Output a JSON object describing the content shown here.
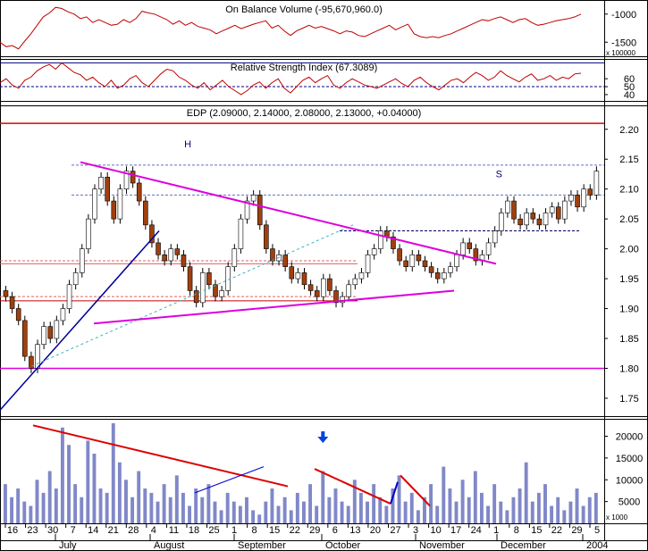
{
  "chart_data": [
    {
      "type": "line",
      "panel": "obv",
      "title": "On Balance Volume (-95,670,960.0)",
      "ylim": [
        -1750,
        -750
      ],
      "yticks": [
        -1500,
        -1000
      ],
      "scale_note": "x 100000",
      "series": [
        {
          "values": [
            -1500,
            -1580,
            -1560,
            -1620,
            -1480,
            -1350,
            -1200,
            -1050,
            -980,
            -880,
            -900,
            -960,
            -1000,
            -1080,
            -1050,
            -1150,
            -1100,
            -1150,
            -1200,
            -1180,
            -1100,
            -1150,
            -1080,
            -950,
            -980,
            -1000,
            -1050,
            -1100,
            -1180,
            -1120,
            -1200,
            -1150,
            -1220,
            -1250,
            -1280,
            -1350,
            -1300,
            -1250,
            -1200,
            -1260,
            -1220,
            -1180,
            -1150,
            -1120,
            -1250,
            -1200,
            -1300,
            -1380,
            -1300,
            -1250,
            -1200,
            -1250,
            -1220,
            -1260,
            -1300,
            -1350,
            -1300,
            -1320,
            -1380,
            -1400,
            -1350,
            -1300,
            -1250,
            -1200,
            -1280,
            -1230,
            -1180,
            -1350,
            -1400,
            -1420,
            -1400,
            -1420,
            -1380,
            -1350,
            -1300,
            -1250,
            -1200,
            -1150,
            -1100,
            -1120,
            -1080,
            -1050,
            -1100,
            -1150,
            -1100,
            -1080,
            -1150,
            -1200,
            -1180,
            -1150,
            -1120,
            -1100,
            -1080,
            -1050,
            -1000
          ]
        }
      ]
    },
    {
      "type": "line",
      "panel": "rsi",
      "title": "Relative Strength Index (67.3089)",
      "ylim": [
        32,
        85
      ],
      "yticks": [
        40,
        50,
        60
      ],
      "reference_lines": [
        80,
        50
      ],
      "series": [
        {
          "values": [
            55,
            60,
            52,
            48,
            58,
            62,
            70,
            75,
            78,
            72,
            80,
            74,
            68,
            65,
            58,
            62,
            55,
            50,
            58,
            48,
            52,
            60,
            64,
            55,
            50,
            58,
            66,
            72,
            70,
            62,
            58,
            52,
            48,
            55,
            46,
            52,
            58,
            50,
            45,
            40,
            45,
            52,
            56,
            48,
            55,
            60,
            48,
            42,
            50,
            58,
            62,
            55,
            60,
            64,
            52,
            48,
            55,
            60,
            56,
            52,
            50,
            48,
            52,
            56,
            60,
            54,
            50,
            58,
            62,
            55,
            50,
            46,
            52,
            58,
            60,
            55,
            62,
            68,
            64,
            58,
            62,
            70,
            64,
            60,
            56,
            62,
            66,
            58,
            60,
            64,
            58,
            62,
            60,
            66,
            67
          ]
        }
      ]
    },
    {
      "type": "candlestick",
      "panel": "price",
      "title": "EDP (2.09000, 2.14000, 2.08000, 2.13000, +0.04000)",
      "ylim": [
        1.72,
        2.24
      ],
      "yticks": [
        1.75,
        1.8,
        1.85,
        1.9,
        1.95,
        2.0,
        2.05,
        2.1,
        2.15,
        2.2
      ],
      "reference_lines": [
        {
          "value": 2.21,
          "color": "#dd0000"
        },
        {
          "value": 1.8,
          "color": "#dd00dd"
        }
      ],
      "annotations": [
        {
          "text": "H",
          "bar": 29
        },
        {
          "text": "S",
          "bar": 78
        }
      ],
      "close": [
        1.92,
        1.9,
        1.88,
        1.82,
        1.8,
        1.84,
        1.87,
        1.85,
        1.88,
        1.9,
        1.94,
        1.96,
        2.0,
        2.05,
        2.1,
        2.12,
        2.08,
        2.05,
        2.1,
        2.13,
        2.11,
        2.08,
        2.04,
        2.01,
        1.99,
        1.98,
        2.0,
        1.99,
        1.97,
        1.93,
        1.91,
        1.96,
        1.94,
        1.92,
        1.93,
        1.97,
        2.0,
        2.05,
        2.08,
        2.09,
        2.04,
        2.0,
        1.98,
        1.99,
        1.97,
        1.95,
        1.96,
        1.94,
        1.93,
        1.92,
        1.95,
        1.93,
        1.91,
        1.92,
        1.94,
        1.95,
        1.96,
        1.99,
        2.0,
        2.03,
        2.02,
        2.0,
        1.98,
        1.97,
        1.99,
        1.98,
        1.97,
        1.96,
        1.95,
        1.96,
        1.97,
        1.99,
        2.01,
        2.0,
        1.98,
        1.99,
        2.01,
        2.03,
        2.06,
        2.08,
        2.05,
        2.04,
        2.06,
        2.05,
        2.04,
        2.06,
        2.07,
        2.05,
        2.08,
        2.09,
        2.07,
        2.1,
        2.09,
        2.13
      ]
    },
    {
      "type": "bar",
      "panel": "volume",
      "ylim": [
        0,
        24000
      ],
      "yticks": [
        5000,
        10000,
        15000,
        20000
      ],
      "scale_note": "x 1000",
      "xtick_labels": [
        "16",
        "23",
        "30",
        "7",
        "14",
        "21",
        "28",
        "4",
        "11",
        "18",
        "25",
        "1",
        "8",
        "15",
        "22",
        "29",
        "6",
        "13",
        "20",
        "27",
        "3",
        "10",
        "17",
        "24",
        "1",
        "8",
        "15",
        "22",
        "29",
        "5"
      ],
      "month_labels": [
        "July",
        "August",
        "September",
        "October",
        "November",
        "December",
        "2004"
      ],
      "annotations": [
        {
          "text": "arrow-down",
          "bar": 50
        }
      ],
      "values": [
        9000,
        6000,
        8000,
        5000,
        4000,
        10000,
        7000,
        12000,
        8000,
        22000,
        18000,
        9000,
        6000,
        19000,
        16000,
        8000,
        7000,
        23000,
        14000,
        10000,
        6000,
        12000,
        8000,
        7000,
        5000,
        9000,
        6000,
        11000,
        7000,
        4000,
        8000,
        6000,
        9000,
        5000,
        3000,
        7000,
        5000,
        4000,
        6000,
        3000,
        2000,
        5000,
        8000,
        4000,
        6000,
        3000,
        7000,
        5000,
        9000,
        4000,
        12000,
        6000,
        8000,
        5000,
        4000,
        10000,
        7000,
        5000,
        9000,
        6000,
        4000,
        8000,
        11000,
        5000,
        7000,
        3000,
        6000,
        9000,
        4000,
        13000,
        8000,
        5000,
        10000,
        6000,
        12000,
        7000,
        4000,
        9000,
        5000,
        3000,
        6000,
        8000,
        14000,
        5000,
        7000,
        9000,
        4000,
        6000,
        3000,
        5000,
        8000,
        4000,
        6000,
        7000
      ]
    }
  ]
}
